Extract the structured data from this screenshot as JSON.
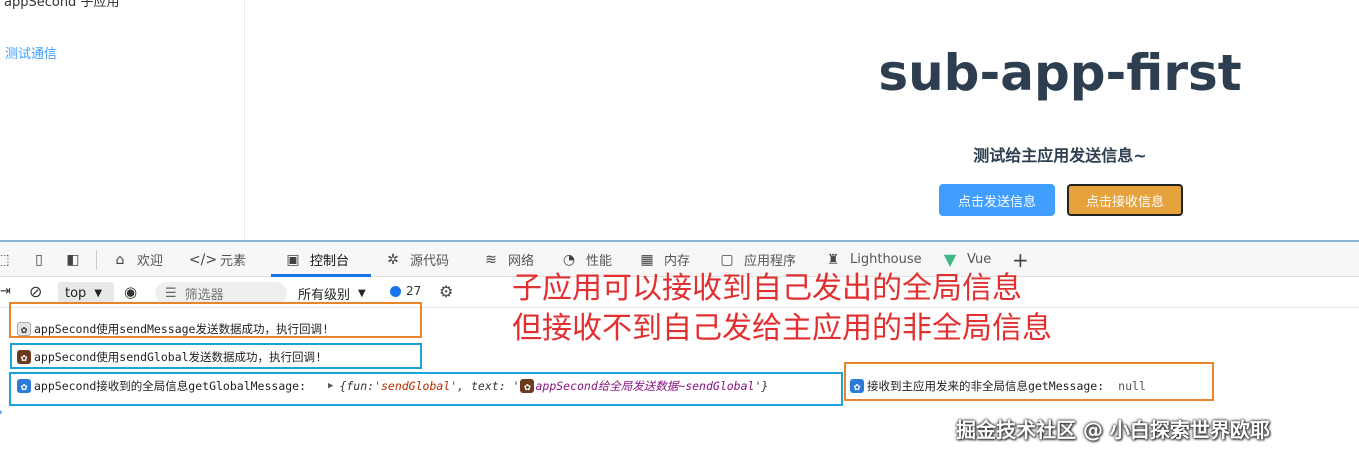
{
  "app": {
    "nav_title_cut": "appSecond 子应用",
    "nav_link": "测试通信",
    "title": "sub-app-first",
    "subtitle": "测试给主应用发送信息~",
    "send_button": "点击发送信息",
    "receive_button": "点击接收信息"
  },
  "devtools": {
    "tabs": [
      {
        "label": "欢迎",
        "icon": "home-icon"
      },
      {
        "label": "元素",
        "icon": "code-icon"
      },
      {
        "label": "控制台",
        "icon": "console-icon"
      },
      {
        "label": "源代码",
        "icon": "bug-icon"
      },
      {
        "label": "网络",
        "icon": "wifi-icon"
      },
      {
        "label": "性能",
        "icon": "gauge-icon"
      },
      {
        "label": "内存",
        "icon": "chip-icon"
      },
      {
        "label": "应用程序",
        "icon": "app-icon"
      },
      {
        "label": "Lighthouse",
        "icon": "lighthouse-icon"
      },
      {
        "label": "Vue",
        "icon": "vue-icon"
      }
    ],
    "active_tab": "控制台",
    "toolbar": {
      "context": "top",
      "filter_placeholder": "筛选器",
      "level": "所有级别",
      "issues_count": "27"
    },
    "logs": {
      "row1": "appSecond使用sendMessage发送数据成功，执行回调!",
      "row2": "appSecond使用sendGlobal发送数据成功，执行回调!",
      "row3_label": "appSecond接收到的全局信息getGlobalMessage:",
      "row3_obj_prefix": "{fun: ",
      "row3_fun": "'sendGlobal'",
      "row3_mid": ", text: '",
      "row3_text": "appSecond给全局发送数据~sendGlobal",
      "row3_end": "'}",
      "row4_label": "接收到主应用发来的非全局信息getMessage:",
      "row4_value": "null"
    }
  },
  "annotation": {
    "line1": "子应用可以接收到自己发出的全局信息",
    "line2": "但接收不到自己发给主应用的非全局信息"
  },
  "watermark": "掘金技术社区 @ 小白探索世界欧耶",
  "colors": {
    "accent_blue": "#409eff",
    "accent_orange": "#e6a23c",
    "annotation_red": "#e23030",
    "box_orange": "#e8842c",
    "box_cyan": "#1aa3d9"
  }
}
